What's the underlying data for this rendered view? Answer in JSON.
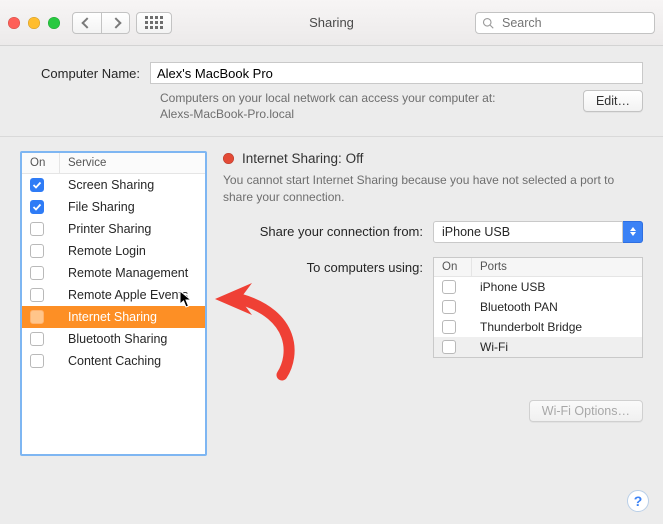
{
  "window": {
    "title": "Sharing",
    "search_placeholder": "Search"
  },
  "computer_name": {
    "label": "Computer Name:",
    "value": "Alex's MacBook Pro",
    "hint_line1": "Computers on your local network can access your computer at:",
    "hint_line2": "Alexs-MacBook-Pro.local",
    "edit_label": "Edit…"
  },
  "services": {
    "head_on": "On",
    "head_service": "Service",
    "items": [
      {
        "on": true,
        "label": "Screen Sharing",
        "selected": false
      },
      {
        "on": true,
        "label": "File Sharing",
        "selected": false
      },
      {
        "on": false,
        "label": "Printer Sharing",
        "selected": false
      },
      {
        "on": false,
        "label": "Remote Login",
        "selected": false
      },
      {
        "on": false,
        "label": "Remote Management",
        "selected": false
      },
      {
        "on": false,
        "label": "Remote Apple Events",
        "selected": false
      },
      {
        "on": false,
        "label": "Internet Sharing",
        "selected": true
      },
      {
        "on": false,
        "label": "Bluetooth Sharing",
        "selected": false
      },
      {
        "on": false,
        "label": "Content Caching",
        "selected": false
      }
    ]
  },
  "detail": {
    "status_title": "Internet Sharing: Off",
    "status_msg": "You cannot start Internet Sharing because you have not selected a port to share your connection.",
    "share_from_label": "Share your connection from:",
    "share_from_value": "iPhone USB",
    "to_label": "To computers using:",
    "ports_head_on": "On",
    "ports_head_ports": "Ports",
    "ports": [
      {
        "on": false,
        "label": "iPhone USB"
      },
      {
        "on": false,
        "label": "Bluetooth PAN"
      },
      {
        "on": false,
        "label": "Thunderbolt Bridge"
      },
      {
        "on": false,
        "label": "Wi-Fi"
      }
    ],
    "wifi_options_label": "Wi-Fi Options…"
  },
  "help_label": "?"
}
